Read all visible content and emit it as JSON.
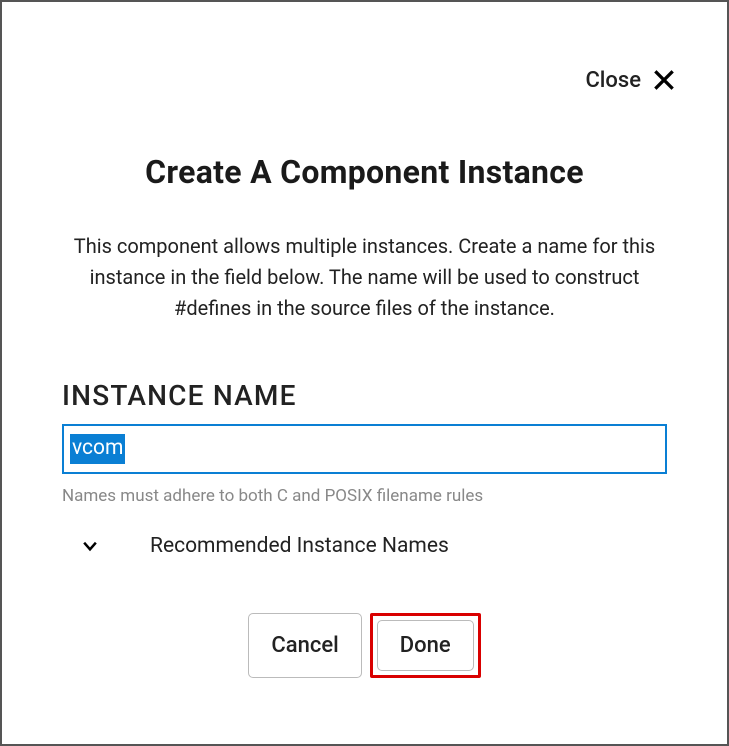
{
  "close": {
    "label": "Close"
  },
  "dialog": {
    "title": "Create A Component Instance",
    "description": "This component allows multiple instances. Create a name for this instance in the field below. The name will be used to construct #defines in the source files of the instance."
  },
  "form": {
    "section_label": "INSTANCE NAME",
    "value": "vcom",
    "hint": "Names must adhere to both C and POSIX filename rules"
  },
  "expander": {
    "label": "Recommended Instance Names"
  },
  "buttons": {
    "cancel": "Cancel",
    "done": "Done"
  }
}
